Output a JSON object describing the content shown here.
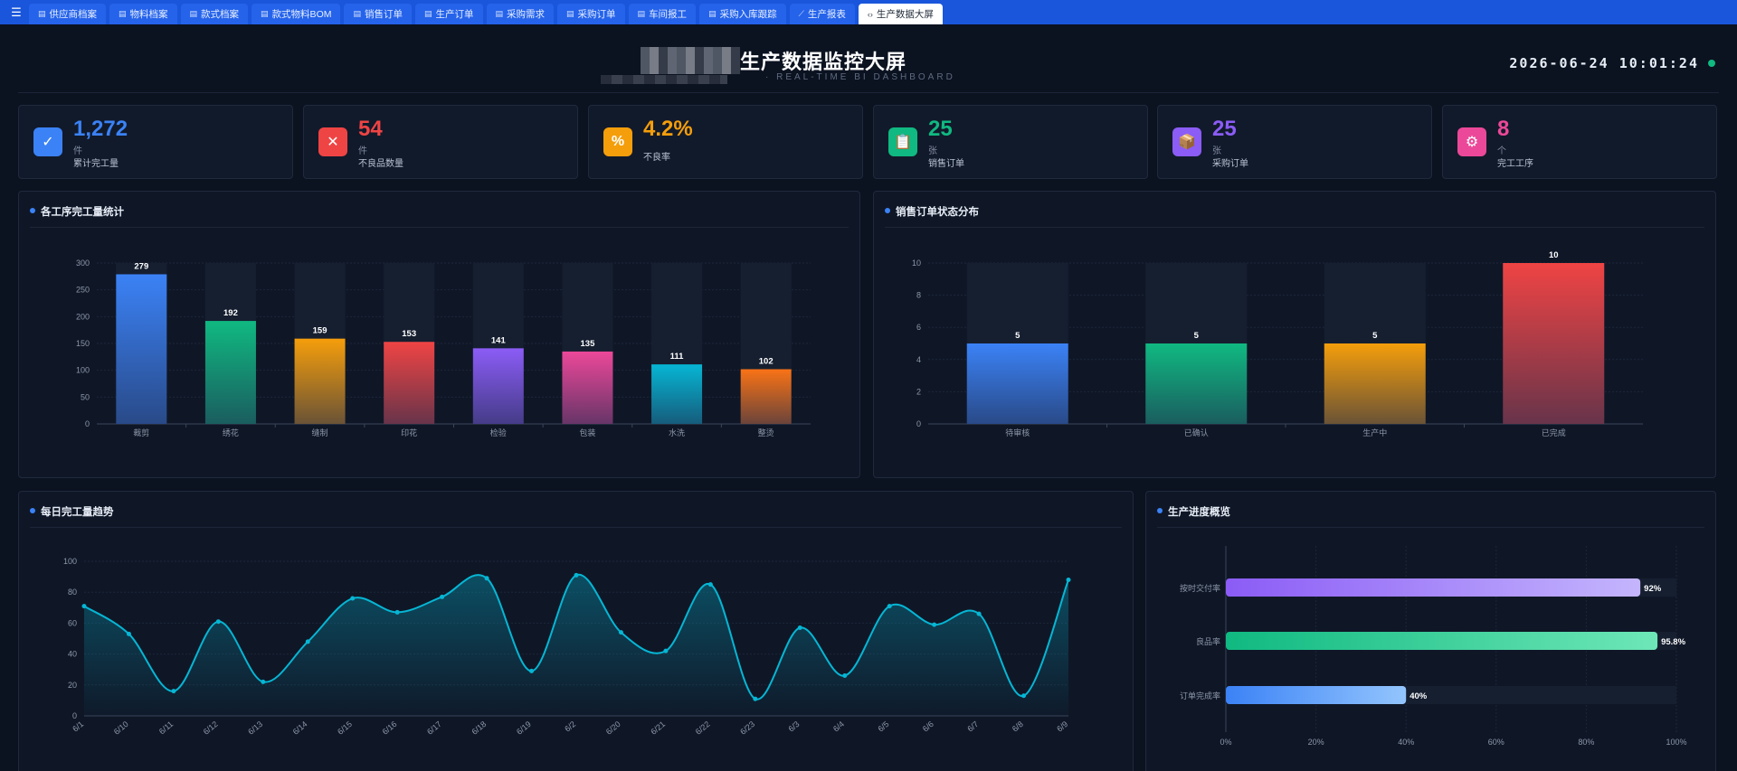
{
  "tabs": [
    {
      "label": "供应商档案",
      "icon": "▤"
    },
    {
      "label": "物料档案",
      "icon": "▤"
    },
    {
      "label": "款式档案",
      "icon": "▤"
    },
    {
      "label": "款式物料BOM",
      "icon": "▤"
    },
    {
      "label": "销售订单",
      "icon": "▤"
    },
    {
      "label": "生产订单",
      "icon": "▤"
    },
    {
      "label": "采购需求",
      "icon": "▤"
    },
    {
      "label": "采购订单",
      "icon": "▤"
    },
    {
      "label": "车间报工",
      "icon": "▤"
    },
    {
      "label": "采购入库跟踪",
      "icon": "▤"
    },
    {
      "label": "生产报表",
      "icon": "⟋"
    },
    {
      "label": "生产数据大屏",
      "icon": "‹›",
      "active": true
    }
  ],
  "header": {
    "title": "生产数据监控大屏",
    "subtitle": "· REAL-TIME BI DASHBOARD",
    "clock": "2026-06-24 10:01:24"
  },
  "kpis": [
    {
      "value": "1,272",
      "unit": "件",
      "label": "累计完工量",
      "color": "#3b82f6",
      "valueColor": "#3b82f6",
      "icon": "✓"
    },
    {
      "value": "54",
      "unit": "件",
      "label": "不良品数量",
      "color": "#ef4444",
      "valueColor": "#ef4444",
      "icon": "✕"
    },
    {
      "value": "4.2%",
      "unit": "",
      "label": "不良率",
      "color": "#f59e0b",
      "valueColor": "#f59e0b",
      "icon": "%"
    },
    {
      "value": "25",
      "unit": "张",
      "label": "销售订单",
      "color": "#10b981",
      "valueColor": "#10b981",
      "icon": "📋"
    },
    {
      "value": "25",
      "unit": "张",
      "label": "采购订单",
      "color": "#8b5cf6",
      "valueColor": "#8b5cf6",
      "icon": "📦"
    },
    {
      "value": "8",
      "unit": "个",
      "label": "完工工序",
      "color": "#ec4899",
      "valueColor": "#ec4899",
      "icon": "⚙"
    }
  ],
  "panels": {
    "process": "各工序完工量统计",
    "sales": "销售订单状态分布",
    "daily": "每日完工量趋势",
    "progress": "生产进度概览"
  },
  "chart_data": [
    {
      "type": "bar",
      "title": "各工序完工量统计",
      "categories": [
        "裁剪",
        "绣花",
        "缝制",
        "印花",
        "检验",
        "包装",
        "水洗",
        "整烫"
      ],
      "values": [
        279,
        192,
        159,
        153,
        141,
        135,
        111,
        102
      ],
      "colors": [
        "#3b82f6",
        "#10b981",
        "#f59e0b",
        "#ef4444",
        "#8b5cf6",
        "#ec4899",
        "#06b6d4",
        "#f97316"
      ],
      "ylim": [
        0,
        300
      ],
      "yticks": [
        0,
        50,
        100,
        150,
        200,
        250,
        300
      ]
    },
    {
      "type": "bar",
      "title": "销售订单状态分布",
      "categories": [
        "待审核",
        "已确认",
        "生产中",
        "已完成"
      ],
      "values": [
        5,
        5,
        5,
        10
      ],
      "colors": [
        "#3b82f6",
        "#10b981",
        "#f59e0b",
        "#ef4444"
      ],
      "ylim": [
        0,
        10
      ],
      "yticks": [
        0,
        2,
        4,
        6,
        8,
        10
      ]
    },
    {
      "type": "area",
      "title": "每日完工量趋势",
      "x": [
        "6/1",
        "6/10",
        "6/11",
        "6/12",
        "6/13",
        "6/14",
        "6/15",
        "6/16",
        "6/17",
        "6/18",
        "6/19",
        "6/2",
        "6/20",
        "6/21",
        "6/22",
        "6/23",
        "6/3",
        "6/4",
        "6/5",
        "6/6",
        "6/7",
        "6/8",
        "6/9"
      ],
      "values": [
        71,
        53,
        16,
        61,
        22,
        48,
        76,
        67,
        77,
        89,
        29,
        91,
        54,
        42,
        85,
        11,
        57,
        26,
        71,
        59,
        66,
        13,
        88
      ],
      "ylim": [
        0,
        100
      ],
      "yticks": [
        0,
        20,
        40,
        60,
        80,
        100
      ],
      "color": "#06b6d4"
    },
    {
      "type": "bar",
      "orientation": "horizontal",
      "title": "生产进度概览",
      "categories": [
        "按时交付率",
        "良品率",
        "订单完成率"
      ],
      "values": [
        92,
        95.8,
        40
      ],
      "labels": [
        "92%",
        "95.8%",
        "40%"
      ],
      "colors": [
        [
          "#8b5cf6",
          "#c4b5fd"
        ],
        [
          "#10b981",
          "#6ee7b7"
        ],
        [
          "#3b82f6",
          "#93c5fd"
        ]
      ],
      "xlim": [
        0,
        100
      ],
      "xticks": [
        "0%",
        "20%",
        "40%",
        "60%",
        "80%",
        "100%"
      ]
    }
  ]
}
